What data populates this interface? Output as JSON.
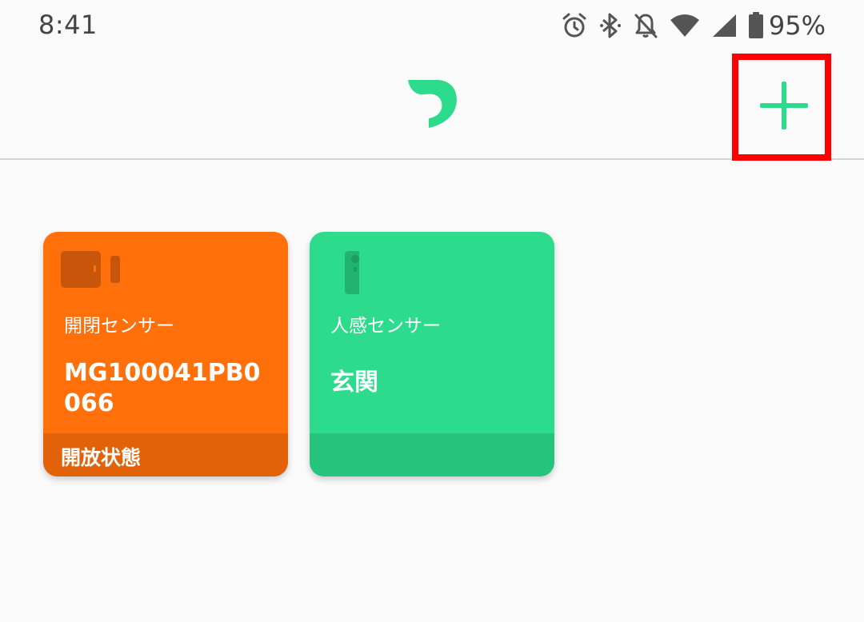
{
  "status_bar": {
    "time": "8:41",
    "battery_percent": "95%",
    "icons": [
      "alarm-icon",
      "bluetooth-icon",
      "notifications-off-icon",
      "wifi-icon",
      "cellular-signal-icon",
      "battery-icon"
    ]
  },
  "app_bar": {
    "logo": "leaf-logo-icon",
    "add_button_icon": "plus-icon",
    "accent_color": "#2ddb8c",
    "highlight_color": "#ff0000"
  },
  "cards": [
    {
      "icon": "door-sensor-icon",
      "type_label": "開閉センサー",
      "name": "MG100041PB0066",
      "status": "開放状態",
      "color": "#ff700a"
    },
    {
      "icon": "motion-sensor-icon",
      "type_label": "人感センサー",
      "name": "玄関",
      "status": "",
      "color": "#2ddb8c"
    }
  ]
}
